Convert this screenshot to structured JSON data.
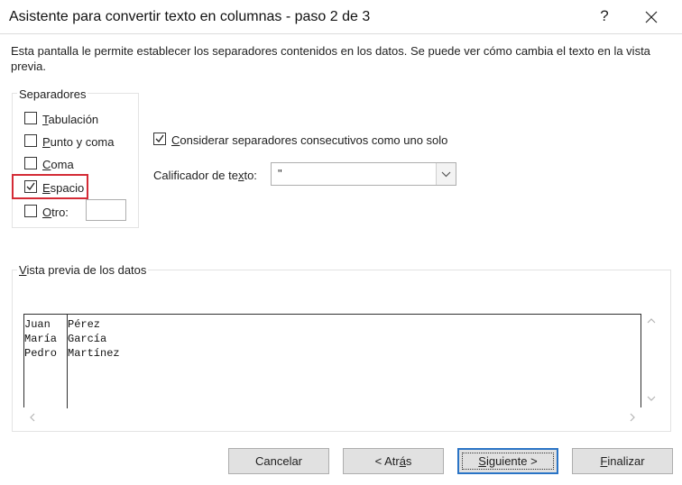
{
  "window": {
    "title": "Asistente para convertir texto en columnas - paso 2 de 3",
    "help_label": "?",
    "close_label": "close"
  },
  "description": "Esta pantalla le permite establecer los separadores contenidos en los datos. Se puede ver cómo cambia el texto en la vista previa.",
  "separators": {
    "legend": "Separadores",
    "tab": {
      "mnemonic": "T",
      "rest": "abulación",
      "checked": false
    },
    "semicolon": {
      "mnemonic": "P",
      "rest": "unto y coma",
      "checked": false
    },
    "comma": {
      "mnemonic": "C",
      "rest": "oma",
      "checked": false
    },
    "space": {
      "mnemonic": "E",
      "rest": "spacio",
      "checked": true
    },
    "other": {
      "mnemonic": "O",
      "rest": "tro:",
      "checked": false,
      "value": ""
    }
  },
  "consecutive": {
    "mnemonic": "C",
    "rest": "onsiderar separadores consecutivos como uno solo",
    "checked": true
  },
  "qualifier": {
    "label_pre": "Calificador de te",
    "mnemonic": "x",
    "label_post": "to:",
    "value": "\""
  },
  "preview": {
    "legend_mnemonic": "V",
    "legend_rest": "ista previa de los datos",
    "rows": [
      [
        "Juan",
        "Pérez"
      ],
      [
        "María",
        "García"
      ],
      [
        "Pedro",
        "Martínez"
      ]
    ]
  },
  "buttons": {
    "cancel": "Cancelar",
    "back_pre": "< Atr",
    "back_mnemonic": "á",
    "back_post": "s",
    "next_mnemonic": "S",
    "next_rest": "iguiente >",
    "finish_mnemonic": "F",
    "finish_rest": "inalizar"
  },
  "colors": {
    "highlight": "#d42b36",
    "default_button_border": "#2a74c6",
    "button_face": "#e1e1e1"
  }
}
